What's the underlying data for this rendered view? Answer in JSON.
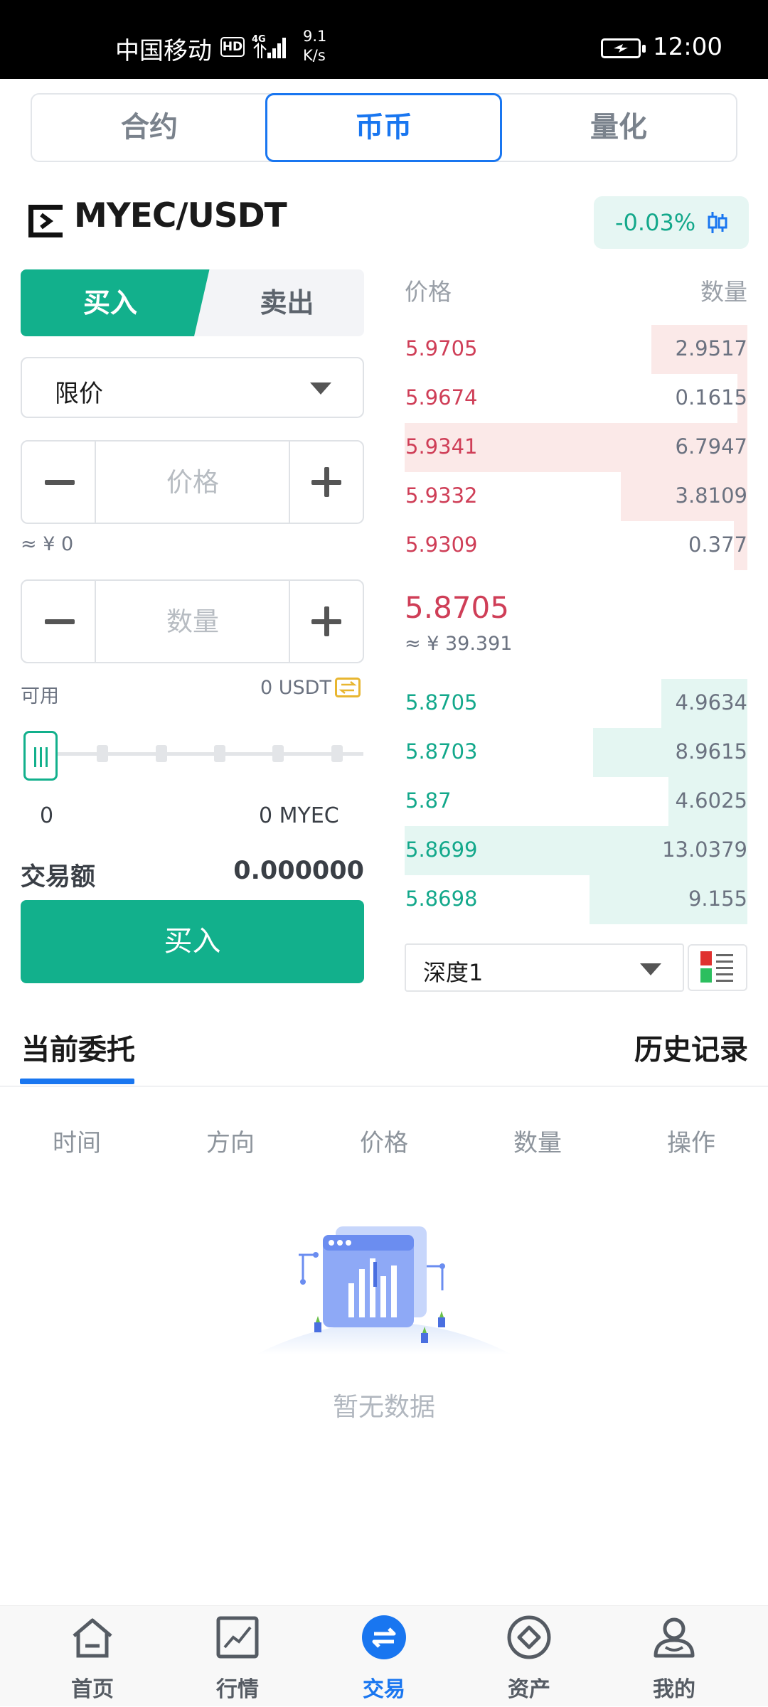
{
  "status_bar": {
    "carrier": "中国移动",
    "hd": "HD",
    "network": "4G",
    "speed_value": "9.1",
    "speed_unit": "K/s",
    "time": "12:00"
  },
  "top_tabs": [
    {
      "label": "合约",
      "active": false
    },
    {
      "label": "币币",
      "active": true
    },
    {
      "label": "量化",
      "active": false
    }
  ],
  "pair": {
    "name": "MYEC/USDT",
    "change": "-0.03%",
    "accent": "#13a88b"
  },
  "trade_form": {
    "buy_tab": "买入",
    "sell_tab": "卖出",
    "order_type": "限价",
    "price_placeholder": "价格",
    "price_cny": "≈ ¥ 0",
    "qty_placeholder": "数量",
    "available_label": "可用",
    "available_value": "0 USDT",
    "slider_percent": 0,
    "slider_min_label": "0",
    "slider_max_label": "0 MYEC",
    "amount_label": "交易额",
    "amount_value": "0.000000",
    "submit_label": "买入"
  },
  "order_book": {
    "price_header": "价格",
    "qty_header": "数量",
    "asks": [
      {
        "price": "5.9705",
        "qty": "2.9517",
        "depth": 0.28
      },
      {
        "price": "5.9674",
        "qty": "0.1615",
        "depth": 0.03
      },
      {
        "price": "5.9341",
        "qty": "6.7947",
        "depth": 1.0
      },
      {
        "price": "5.9332",
        "qty": "3.8109",
        "depth": 0.37
      },
      {
        "price": "5.9309",
        "qty": "0.377",
        "depth": 0.04
      }
    ],
    "last_price": "5.8705",
    "last_price_cny": "≈ ¥ 39.391",
    "bids": [
      {
        "price": "5.8705",
        "qty": "4.9634",
        "depth": 0.25
      },
      {
        "price": "5.8703",
        "qty": "8.9615",
        "depth": 0.45
      },
      {
        "price": "5.87",
        "qty": "4.6025",
        "depth": 0.23
      },
      {
        "price": "5.8699",
        "qty": "13.0379",
        "depth": 1.0
      },
      {
        "price": "5.8698",
        "qty": "9.155",
        "depth": 0.46
      }
    ],
    "depth_select": "深度1"
  },
  "orders": {
    "tab_current": "当前委托",
    "tab_history": "历史记录",
    "columns": [
      "时间",
      "方向",
      "价格",
      "数量",
      "操作"
    ],
    "empty_text": "暂无数据"
  },
  "bottom_nav": [
    {
      "label": "首页",
      "icon": "home-icon",
      "active": false
    },
    {
      "label": "行情",
      "icon": "chart-icon",
      "active": false
    },
    {
      "label": "交易",
      "icon": "exchange-icon",
      "active": true
    },
    {
      "label": "资产",
      "icon": "assets-icon",
      "active": false
    },
    {
      "label": "我的",
      "icon": "profile-icon",
      "active": false
    }
  ],
  "colors": {
    "brand_green": "#12b08c",
    "ask_red": "#cf3e57",
    "active_blue": "#1976f0"
  }
}
